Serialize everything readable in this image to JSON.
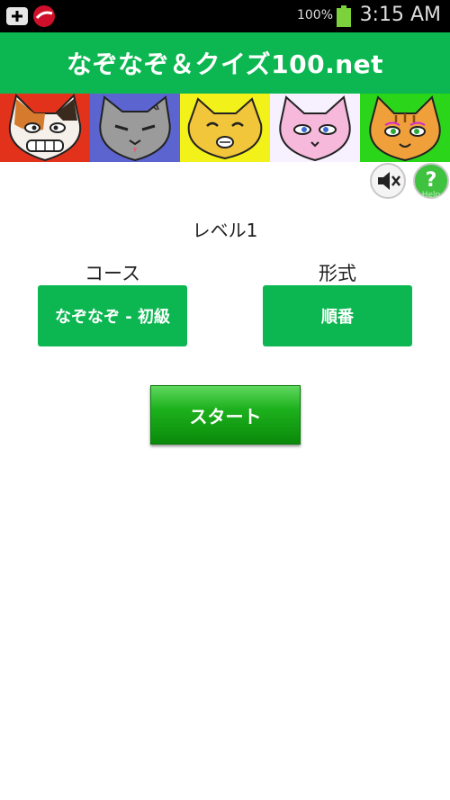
{
  "status_bar": {
    "battery_percent": "100%",
    "time": "3:15 AM",
    "icons": [
      "app-add-icon",
      "trend-micro-icon",
      "battery-icon"
    ]
  },
  "header": {
    "title": "なぞなぞ＆クイズ100.net"
  },
  "banner": {
    "cats": [
      "calico-cat",
      "gray-cat",
      "yellow-cat",
      "pink-cat",
      "orange-tabby-cat"
    ]
  },
  "controls": {
    "mute_icon": "speaker-mute-icon",
    "help_icon": "help-icon",
    "help_label": "Help"
  },
  "main": {
    "level": "レベル1",
    "course_label": "コース",
    "course_value": "なぞなぞ - 初級",
    "format_label": "形式",
    "format_value": "順番",
    "start_label": "スタート"
  },
  "colors": {
    "accent": "#0cb751"
  }
}
